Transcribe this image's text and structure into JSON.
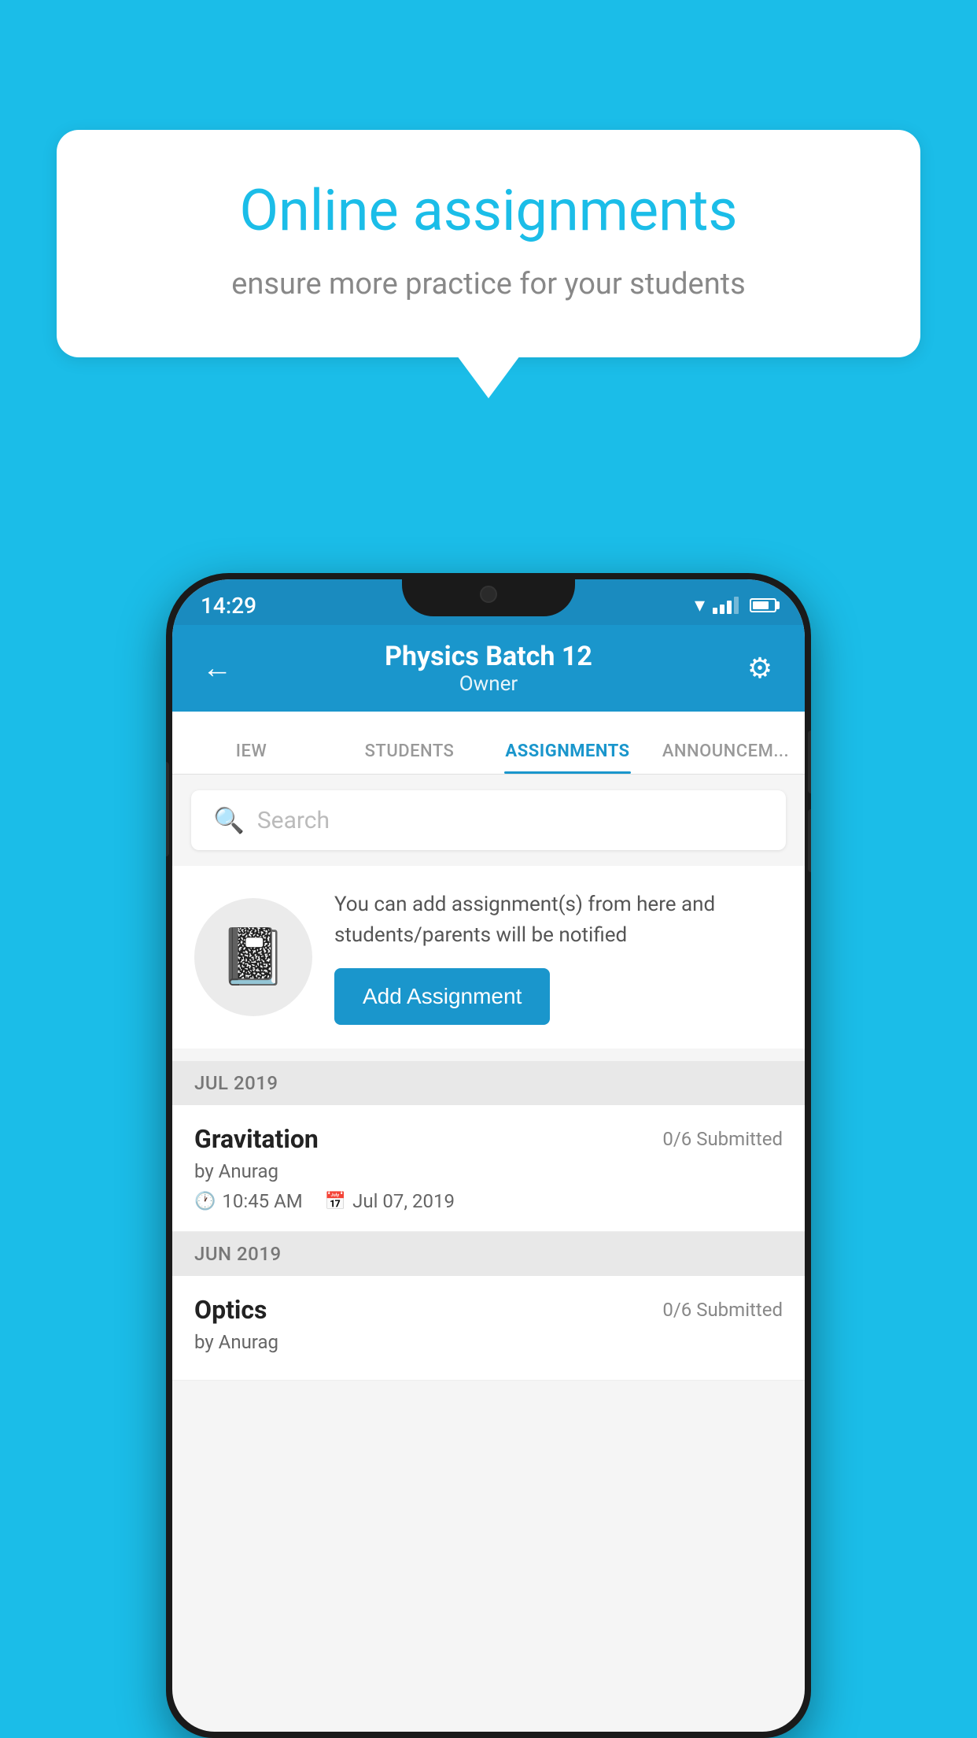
{
  "page": {
    "background_color": "#1BBDE8"
  },
  "speech_bubble": {
    "title": "Online assignments",
    "subtitle": "ensure more practice for your students"
  },
  "status_bar": {
    "time": "14:29"
  },
  "app_header": {
    "title": "Physics Batch 12",
    "subtitle": "Owner",
    "back_label": "←",
    "settings_label": "⚙"
  },
  "tabs": [
    {
      "label": "IEW",
      "active": false
    },
    {
      "label": "STUDENTS",
      "active": false
    },
    {
      "label": "ASSIGNMENTS",
      "active": true
    },
    {
      "label": "ANNOUNCEM...",
      "active": false
    }
  ],
  "search": {
    "placeholder": "Search"
  },
  "add_assignment_section": {
    "description": "You can add assignment(s) from here and students/parents will be notified",
    "button_label": "Add Assignment"
  },
  "months": [
    {
      "label": "JUL 2019",
      "assignments": [
        {
          "title": "Gravitation",
          "submitted": "0/6 Submitted",
          "author": "by Anurag",
          "time": "10:45 AM",
          "date": "Jul 07, 2019"
        }
      ]
    },
    {
      "label": "JUN 2019",
      "assignments": [
        {
          "title": "Optics",
          "submitted": "0/6 Submitted",
          "author": "by Anurag",
          "time": "",
          "date": ""
        }
      ]
    }
  ]
}
